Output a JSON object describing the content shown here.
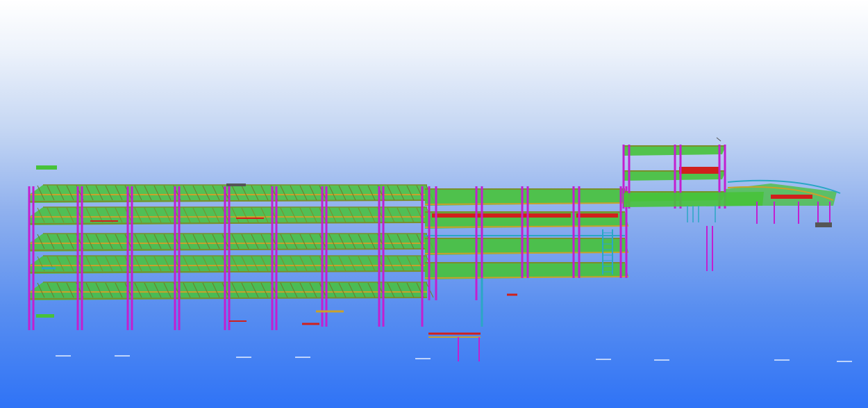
{
  "scene": {
    "view": "3d-structural-model",
    "colors": {
      "column": "#c21fd0",
      "slab": "#47c23a",
      "beam_gold": "#c9a12b",
      "beam_olive": "#7a8f2a",
      "brace_cyan": "#2aa7c4",
      "red_member": "#d0201c",
      "grey_member": "#555555"
    }
  }
}
